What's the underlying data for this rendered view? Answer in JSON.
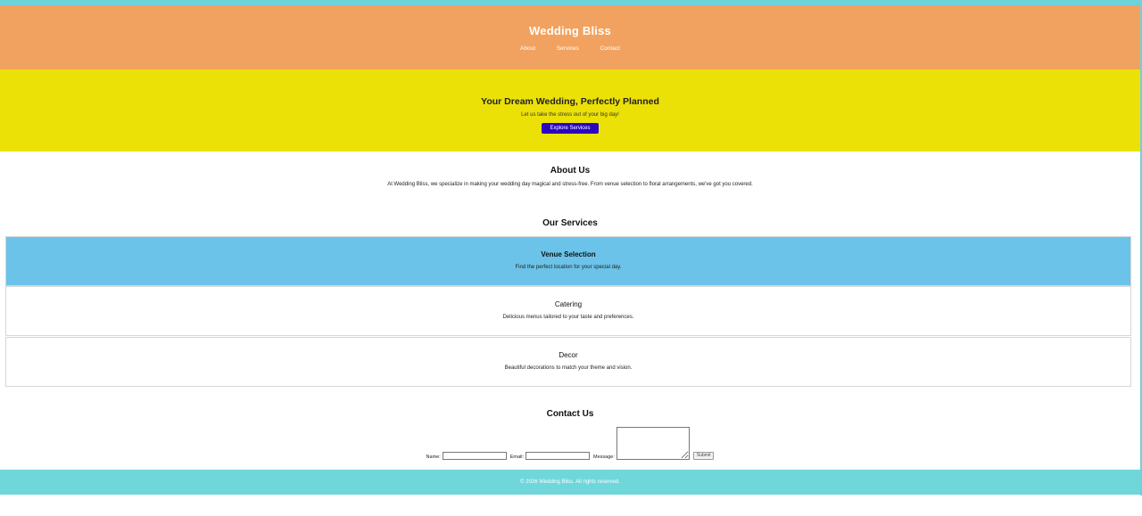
{
  "header": {
    "title": "Wedding Bliss",
    "nav": [
      "About",
      "Services",
      "Contact"
    ]
  },
  "hero": {
    "title": "Your Dream Wedding, Perfectly Planned",
    "subtitle": "Let us take the stress out of your big day!",
    "cta_label": "Explore Services"
  },
  "about": {
    "title": "About Us",
    "text": "At Wedding Bliss, we specialize in making your wedding day magical and stress-free. From venue selection to floral arrangements, we've got you covered."
  },
  "services": {
    "title": "Our Services",
    "items": [
      {
        "title": "Venue Selection",
        "description": "Find the perfect location for your special day."
      },
      {
        "title": "Catering",
        "description": "Delicious menus tailored to your taste and preferences."
      },
      {
        "title": "Decor",
        "description": "Beautiful decorations to match your theme and vision."
      }
    ]
  },
  "contact": {
    "title": "Contact Us",
    "name_label": "Name:",
    "email_label": "Email:",
    "message_label": "Message:",
    "name_value": "",
    "email_value": "",
    "message_value": "",
    "submit_label": "Submit"
  },
  "footer": {
    "copyright": "© 2026 Wedding Bliss. All rights reserved."
  },
  "colors": {
    "header_bg": "#f2a260",
    "hero_bg": "#ece107",
    "cta_bg": "#2a05c0",
    "service_active_bg": "#6bc3e9",
    "footer_bg": "#6fd6da"
  }
}
